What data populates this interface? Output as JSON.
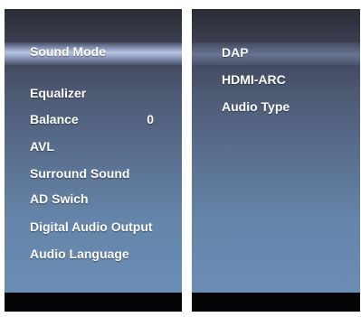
{
  "left_menu": {
    "items": [
      {
        "label": "Sound Mode",
        "value": ""
      },
      {
        "label": "Equalizer",
        "value": ""
      },
      {
        "label": "Balance",
        "value": "0"
      },
      {
        "label": "AVL",
        "value": ""
      },
      {
        "label": "Surround Sound",
        "value": ""
      },
      {
        "label": "AD Swich",
        "value": ""
      },
      {
        "label": "Digital Audio Output",
        "value": ""
      },
      {
        "label": "Audio Language",
        "value": ""
      }
    ],
    "selected_index": 0
  },
  "right_menu": {
    "items": [
      {
        "label": "DAP"
      },
      {
        "label": "HDMI-ARC"
      },
      {
        "label": "Audio Type"
      }
    ],
    "selected_index": 0
  },
  "colors": {
    "text": "#ffffff",
    "panel_top": "#2a2c35",
    "panel_bottom": "#6c8fb6",
    "footer": "#050507"
  }
}
